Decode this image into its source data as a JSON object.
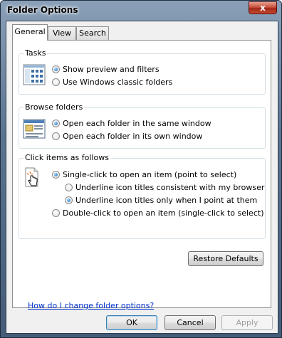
{
  "window": {
    "title": "Folder Options",
    "close_glyph": "x"
  },
  "tabs": [
    {
      "label": "General",
      "active": true
    },
    {
      "label": "View",
      "active": false
    },
    {
      "label": "Search",
      "active": false
    }
  ],
  "tasks": {
    "label": "Tasks",
    "options": [
      {
        "label": "Show preview and filters",
        "checked": true
      },
      {
        "label": "Use Windows classic folders",
        "checked": false
      }
    ]
  },
  "browse": {
    "label": "Browse folders",
    "options": [
      {
        "label": "Open each folder in the same window",
        "checked": true
      },
      {
        "label": "Open each folder in its own window",
        "checked": false
      }
    ]
  },
  "click": {
    "label": "Click items as follows",
    "single": {
      "label": "Single-click to open an item (point to select)",
      "checked": true
    },
    "underline_consistent": {
      "label": "Underline icon titles consistent with my browser",
      "checked": false
    },
    "underline_point": {
      "label": "Underline icon titles only when I point at them",
      "checked": true
    },
    "double": {
      "label": "Double-click to open an item (single-click to select)",
      "checked": false
    }
  },
  "restore_defaults": "Restore Defaults",
  "help_link": "How do I change folder options?",
  "buttons": {
    "ok": "OK",
    "cancel": "Cancel",
    "apply": "Apply"
  },
  "colors": {
    "accent": "#1a5fb4",
    "link": "#0033cc"
  }
}
